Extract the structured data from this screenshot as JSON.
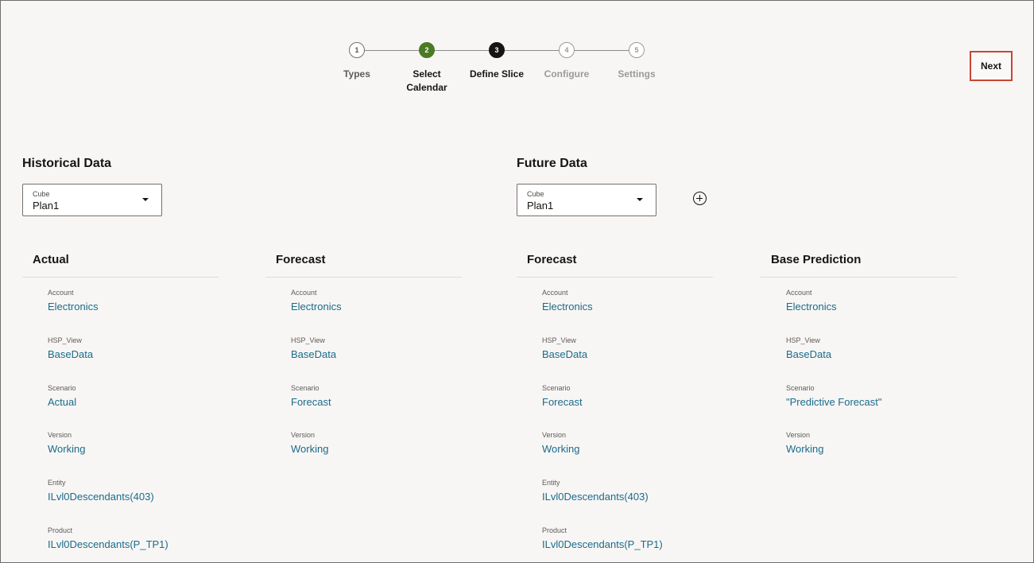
{
  "stepper": {
    "steps": [
      {
        "number": "1",
        "label": "Types",
        "state": "completed"
      },
      {
        "number": "2",
        "label": "Select Calendar",
        "state": "done"
      },
      {
        "number": "3",
        "label": "Define Slice",
        "state": "current"
      },
      {
        "number": "4",
        "label": "Configure",
        "state": "future"
      },
      {
        "number": "5",
        "label": "Settings",
        "state": "future"
      }
    ]
  },
  "next_label": "Next",
  "historical": {
    "title": "Historical Data",
    "cube": {
      "label": "Cube",
      "value": "Plan1"
    }
  },
  "future": {
    "title": "Future Data",
    "cube": {
      "label": "Cube",
      "value": "Plan1"
    }
  },
  "columns": [
    {
      "title": "Actual",
      "fields": [
        {
          "label": "Account",
          "value": "Electronics"
        },
        {
          "label": "HSP_View",
          "value": "BaseData"
        },
        {
          "label": "Scenario",
          "value": "Actual"
        },
        {
          "label": "Version",
          "value": "Working"
        },
        {
          "label": "Entity",
          "value": "ILvl0Descendants(403)"
        },
        {
          "label": "Product",
          "value": "ILvl0Descendants(P_TP1)"
        }
      ]
    },
    {
      "title": "Forecast",
      "fields": [
        {
          "label": "Account",
          "value": "Electronics"
        },
        {
          "label": "HSP_View",
          "value": "BaseData"
        },
        {
          "label": "Scenario",
          "value": "Forecast"
        },
        {
          "label": "Version",
          "value": "Working"
        }
      ]
    },
    {
      "title": "Forecast",
      "fields": [
        {
          "label": "Account",
          "value": "Electronics"
        },
        {
          "label": "HSP_View",
          "value": "BaseData"
        },
        {
          "label": "Scenario",
          "value": "Forecast"
        },
        {
          "label": "Version",
          "value": "Working"
        },
        {
          "label": "Entity",
          "value": "ILvl0Descendants(403)"
        },
        {
          "label": "Product",
          "value": "ILvl0Descendants(P_TP1)"
        }
      ]
    },
    {
      "title": "Base Prediction",
      "fields": [
        {
          "label": "Account",
          "value": "Electronics"
        },
        {
          "label": "HSP_View",
          "value": "BaseData"
        },
        {
          "label": "Scenario",
          "value": "\"Predictive Forecast\""
        },
        {
          "label": "Version",
          "value": "Working"
        }
      ]
    }
  ]
}
